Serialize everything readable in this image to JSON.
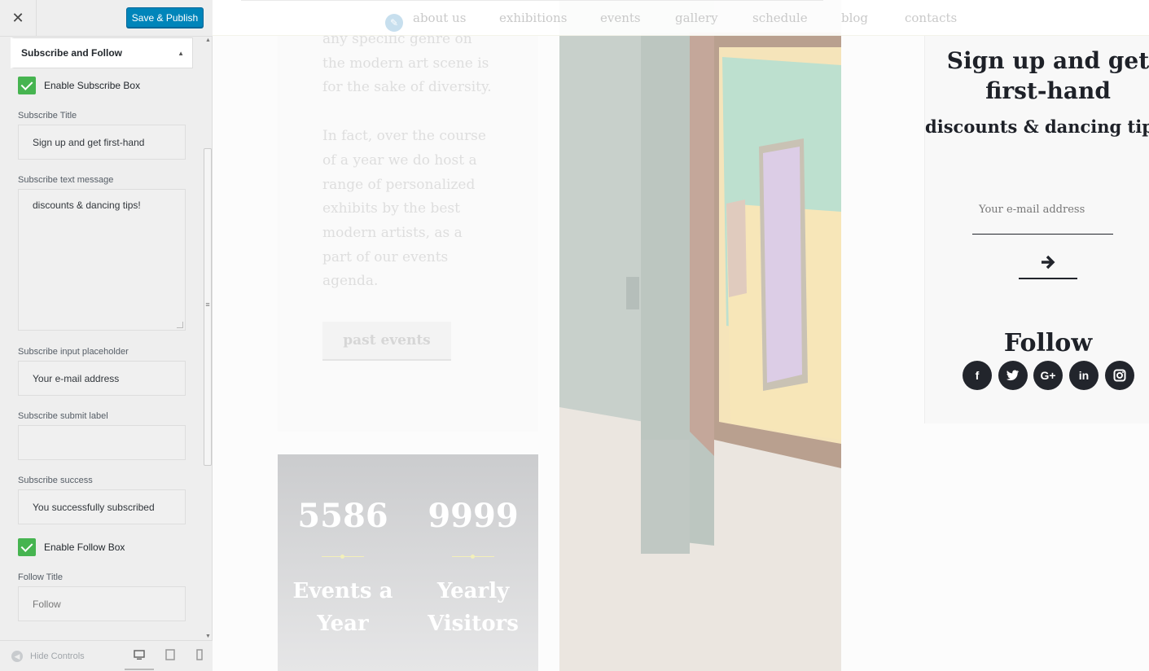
{
  "customizer": {
    "close_label": "✕",
    "save_label": "Save & Publish",
    "section_title": "Subscribe and Follow",
    "enable_subscribe_label": "Enable Subscribe Box",
    "enable_subscribe_checked": true,
    "fields": {
      "subscribe_title": {
        "label": "Subscribe Title",
        "value": "Sign up and get first-hand"
      },
      "subscribe_text": {
        "label": "Subscribe text message",
        "value": "discounts & dancing tips!"
      },
      "subscribe_placeholder": {
        "label": "Subscribe input placeholder",
        "value": "Your e-mail address"
      },
      "subscribe_submit": {
        "label": "Subscribe submit label",
        "value": ""
      },
      "subscribe_success": {
        "label": "Subscribe success",
        "value": "You successfully subscribed"
      },
      "follow_title": {
        "label": "Follow Title",
        "placeholder": "Follow"
      }
    },
    "enable_follow_label": "Enable Follow Box",
    "enable_follow_checked": true,
    "hide_controls_label": "Hide Controls",
    "accent_color": "#0085ba",
    "check_color": "#46b450"
  },
  "preview": {
    "nav": [
      "about us",
      "exhibitions",
      "events",
      "gallery",
      "schedule",
      "blog",
      "contacts"
    ],
    "body_paragraphs": [
      "any specific genre on the modern art scene is for the sake of diversity.",
      "In fact, over the course of a year we do host a range of personalized exhibits by the best modern artists, as a part of our events agenda."
    ],
    "past_events_label": "past events",
    "stats": [
      {
        "number": "5586",
        "label": "Events a Year"
      },
      {
        "number": "9999",
        "label": "Yearly Visitors"
      }
    ],
    "widget": {
      "title": "Sign up and get first-hand",
      "text": "discounts & dancing tips!",
      "email_placeholder": "Your e-mail address",
      "follow_title": "Follow",
      "social": [
        "facebook",
        "twitter",
        "google-plus",
        "linkedin",
        "instagram"
      ]
    }
  }
}
